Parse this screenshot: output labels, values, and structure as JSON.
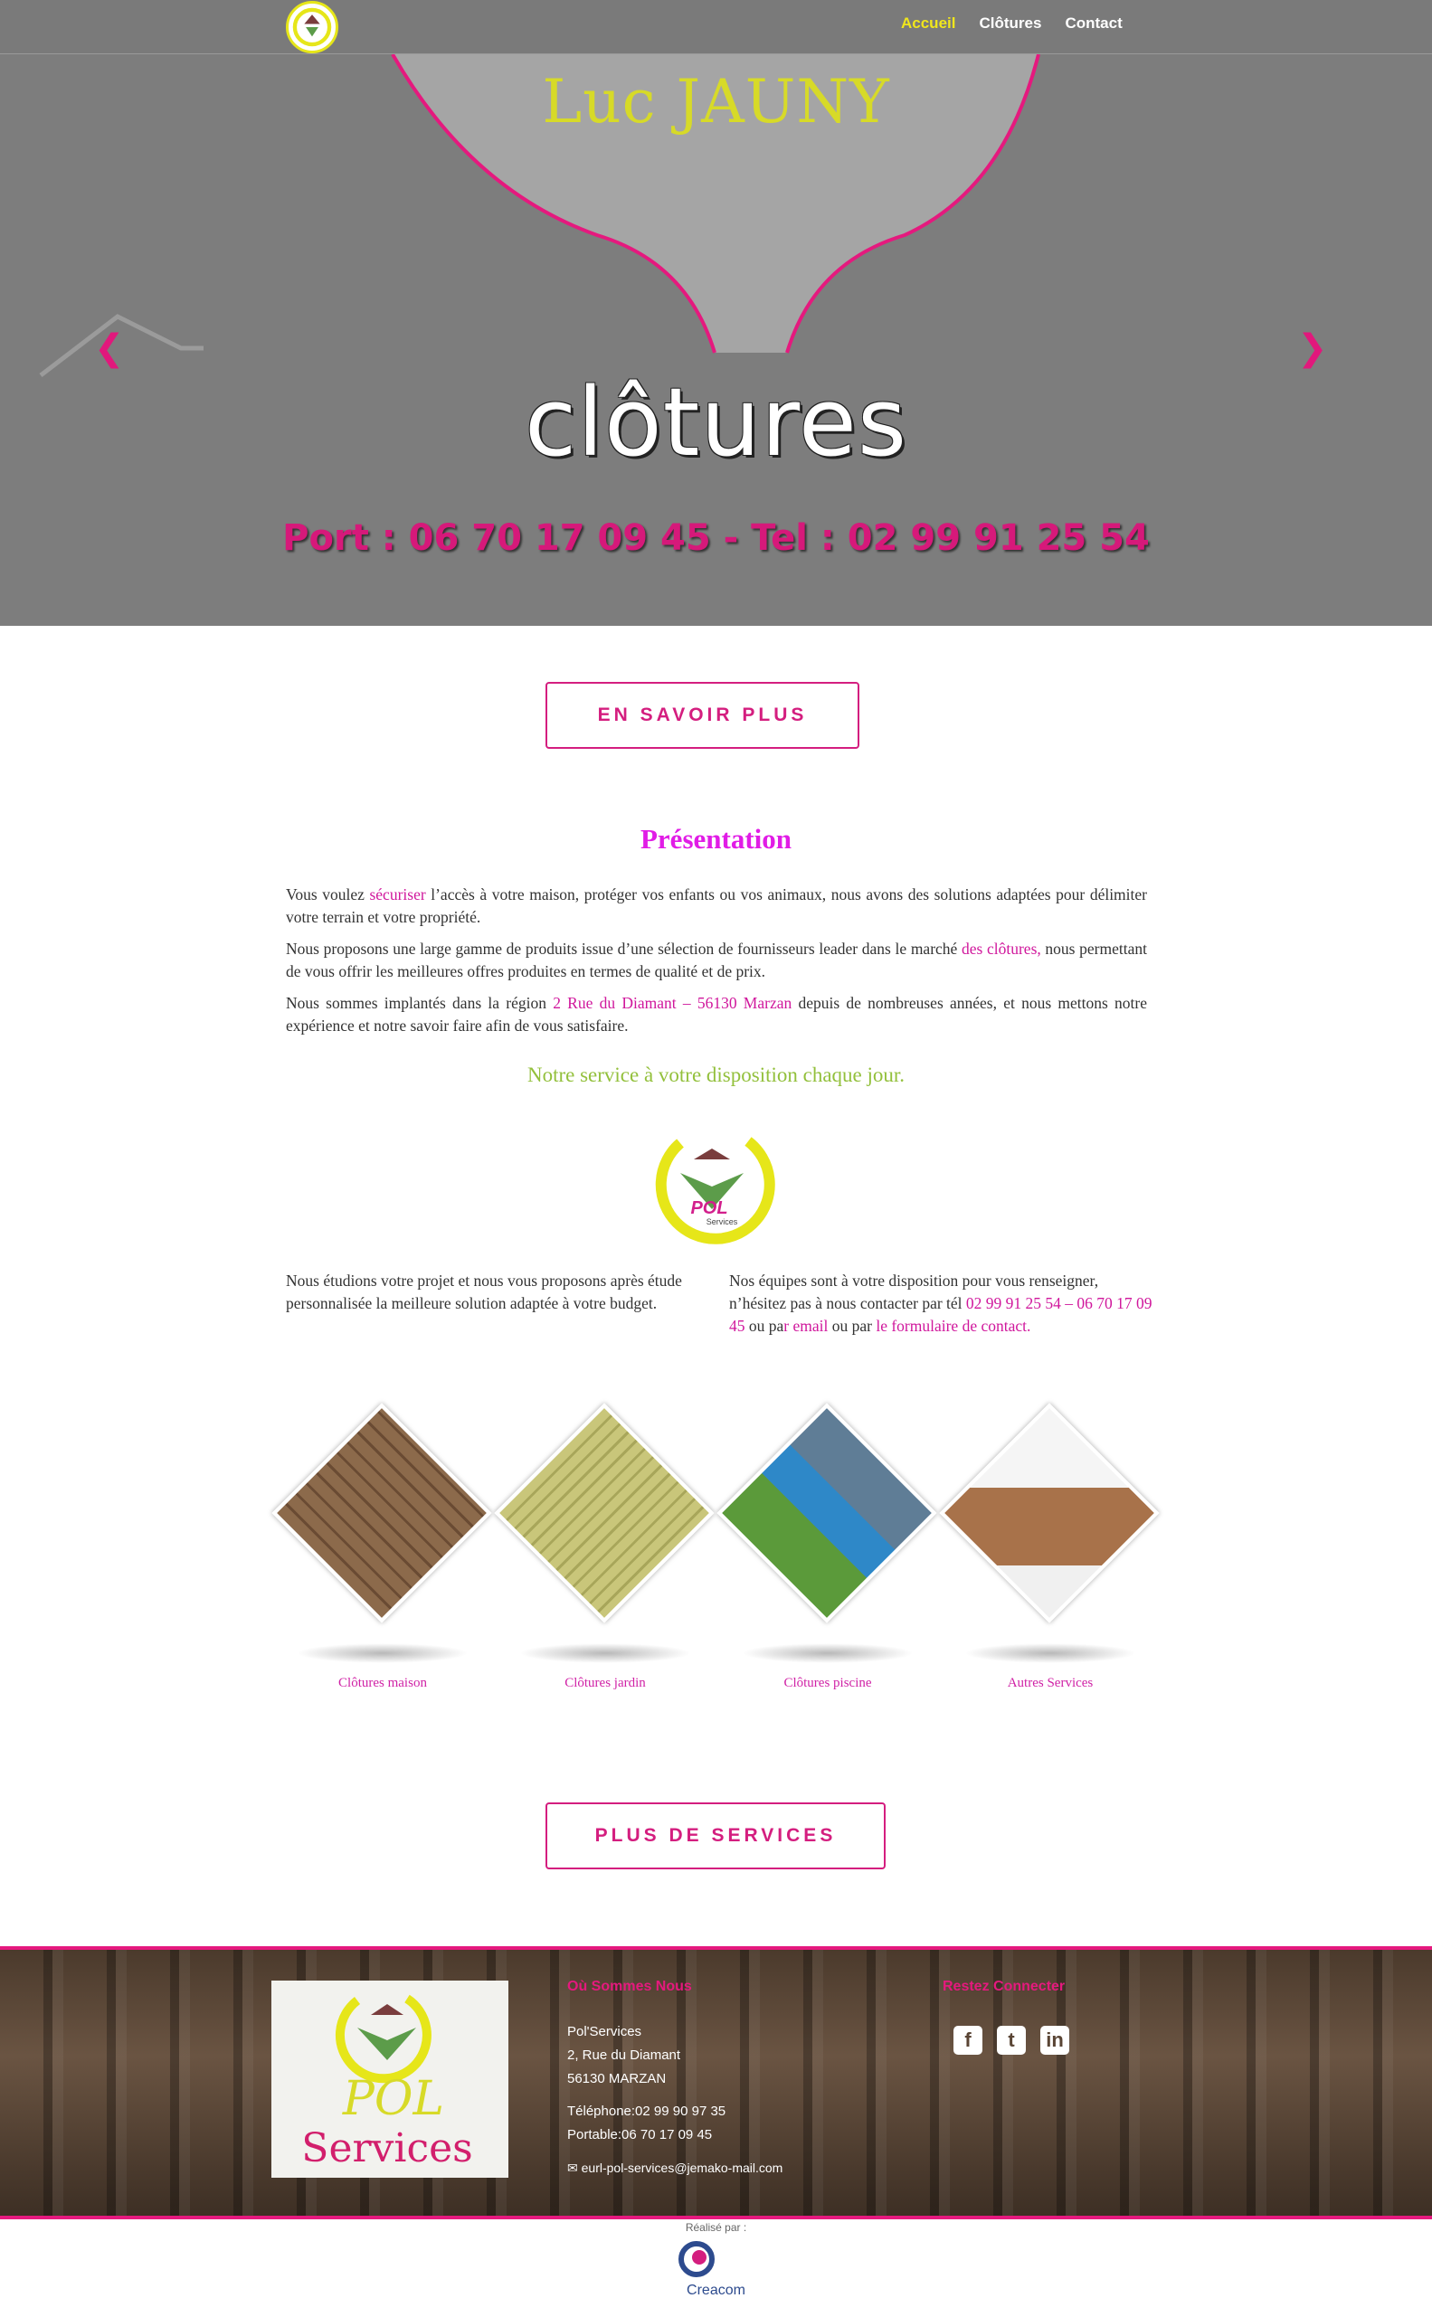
{
  "nav": {
    "items": [
      {
        "label": "Accueil"
      },
      {
        "label": "Clôtures"
      },
      {
        "label": "Contact"
      }
    ]
  },
  "hero": {
    "name": "Luc JAUNY",
    "title": "clôtures",
    "phone": "Port : 06 70 17 09 45 - Tel : 02 99 91 25 54",
    "prev_icon": "chevron-left-icon",
    "next_icon": "chevron-right-icon"
  },
  "buttons": {
    "more": "EN SAVOIR PLUS",
    "services": "PLUS DE SERVICES"
  },
  "presentation": {
    "title": "Présentation",
    "p1_a": "Vous voulez ",
    "p1_link": "sécuriser",
    "p1_b": " l’accès à votre maison, protéger vos enfants ou vos animaux, nous avons des solutions adaptées pour délimiter votre terrain et votre propriété.",
    "p2_a": "Nous proposons une large gamme de produits issue d’une sélection de fournisseurs leader  dans le marché ",
    "p2_link": "des clôtures,",
    "p2_b": " nous permettant de vous offrir les meilleures offres produites en termes de qualité et de prix.",
    "p3_a": "Nous sommes implantés dans la région ",
    "p3_link": "2 Rue du Diamant – 56130 Marzan",
    "p3_b": " depuis de nombreuses années, et nous mettons notre expérience et notre savoir faire afin de vous satisfaire.",
    "tagline": "Notre service à votre disposition chaque jour."
  },
  "columns": {
    "left": "Nous étudions votre projet et nous vous proposons après étude personnalisée la meilleure solution adaptée à votre budget.",
    "right_a": "Nos équipes sont à votre disposition pour  vous renseigner, n’hésitez pas à nous contacter par tél ",
    "right_phone": "02 99 91 25 54 – 06 70 17 09 45",
    "right_b": " ou pa",
    "right_email": "r email",
    "right_c": " ou par ",
    "right_form": "le formulaire de contact."
  },
  "services": [
    {
      "label": "Clôtures maison"
    },
    {
      "label": "Clôtures jardin"
    },
    {
      "label": "Clôtures piscine"
    },
    {
      "label": "Autres Services"
    }
  ],
  "footer": {
    "where_title": "Où Sommes Nous",
    "connect_title": "Restez Connecter",
    "company": "Pol'Services",
    "street": "2, Rue du Diamant",
    "city": "56130 MARZAN",
    "phone": "Téléphone:02 99 90 97 35",
    "mobile": "Portable:06 70 17 09 45",
    "email": "eurl-pol-services@jemako-mail.com",
    "logo_top": "POL",
    "logo_small": "Services",
    "logo_text_1": "POL",
    "logo_text_2": "Services",
    "socials": [
      {
        "icon": "facebook-icon",
        "glyph": "f"
      },
      {
        "icon": "twitter-icon",
        "glyph": "t"
      },
      {
        "icon": "linkedin-icon",
        "glyph": "in"
      }
    ]
  },
  "credit": {
    "label": "Réalisé par :",
    "name": "Creacom"
  },
  "colors": {
    "accent_pink": "#d41e7f",
    "magenta": "#e11ce6",
    "olive_green": "#93c03c",
    "nav_active": "#f0e61c",
    "hero_bg": "#7d7d7d"
  }
}
